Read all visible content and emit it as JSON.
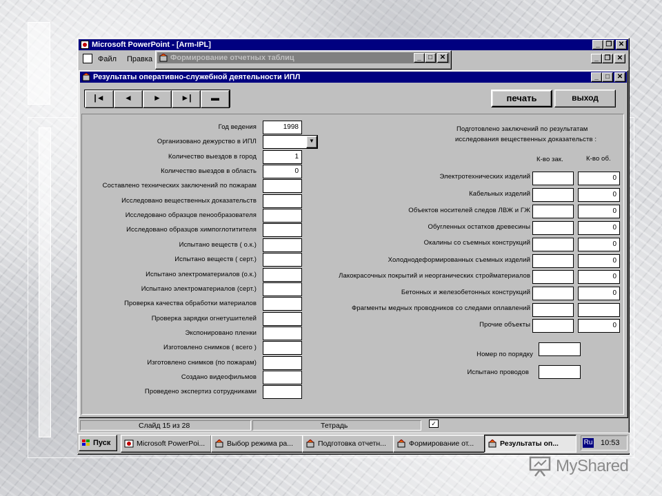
{
  "powerpoint": {
    "title": "Microsoft PowerPoint - [Arm-IPL]",
    "menu": [
      "Файл",
      "Правка"
    ]
  },
  "window_forming": {
    "title": "Формирование отчетных таблиц"
  },
  "window_results": {
    "title": "Результаты оперативно-служебной деятельности  ИПЛ"
  },
  "toolbar": {
    "nav": [
      "|◄",
      "◄",
      "►",
      "►|",
      "▬"
    ],
    "print_label": "печать",
    "exit_label": "выход"
  },
  "left_form": [
    {
      "label": "Год ведения",
      "value": "1998",
      "type": "text"
    },
    {
      "label": "Организовано дежурство в ИПЛ",
      "value": "",
      "type": "combo"
    },
    {
      "label": "Количество выездов в город",
      "value": "1",
      "type": "text"
    },
    {
      "label": "Количество выездов в область",
      "value": "0",
      "type": "text"
    },
    {
      "label": "Составлено технических заключений по пожарам",
      "value": "",
      "type": "text"
    },
    {
      "label": "Исследовано вещественных доказательств",
      "value": "",
      "type": "text"
    },
    {
      "label": "Исследовано образцов пенообразователя",
      "value": "",
      "type": "text"
    },
    {
      "label": "Исследовано образцов химпоглотитителя",
      "value": "",
      "type": "text"
    },
    {
      "label": "Испытано веществ ( о.к.)",
      "value": "",
      "type": "text"
    },
    {
      "label": "Испытано веществ ( серт.)",
      "value": "",
      "type": "text"
    },
    {
      "label": "Испытано электроматериалов (о.к.)",
      "value": "",
      "type": "text"
    },
    {
      "label": "Испытано электроматериалов (серт.)",
      "value": "",
      "type": "text"
    },
    {
      "label": "Проверка качества обработки материалов",
      "value": "",
      "type": "text"
    },
    {
      "label": "Проверка зарядки огнетушителей",
      "value": "",
      "type": "text"
    },
    {
      "label": "Экспонировано пленки",
      "value": "",
      "type": "text"
    },
    {
      "label": "Изготовлено снимков ( всего )",
      "value": "",
      "type": "text"
    },
    {
      "label": "Изготовлено снимков (по пожарам)",
      "value": "",
      "type": "text"
    },
    {
      "label": "Создано видеофильмов",
      "value": "",
      "type": "text"
    },
    {
      "label": "Проведено экспертиз сотрудниками",
      "value": "",
      "type": "text"
    }
  ],
  "right_panel": {
    "heading_line1": "Подготовлено заключений по результатам",
    "heading_line2": "исследования вещественных доказательств :",
    "col1": "К-во зак.",
    "col2": "К-во об.",
    "rows": [
      {
        "label": "Электротехнических изделий",
        "zak": "",
        "ob": "0"
      },
      {
        "label": "Кабельных изделий",
        "zak": "",
        "ob": "0"
      },
      {
        "label": "Объектов носителей следов ЛВЖ и ГЖ",
        "zak": "",
        "ob": "0"
      },
      {
        "label": "Обугленных остатков древесины",
        "zak": "",
        "ob": "0"
      },
      {
        "label": "Окалины со съемных конструкций",
        "zak": "",
        "ob": "0"
      },
      {
        "label": "Холоднодеформированных съемных изделий",
        "zak": "",
        "ob": "0"
      },
      {
        "label": "Лакокрасочных покрытий и неорганических стройматериалов",
        "zak": "",
        "ob": "0"
      },
      {
        "label": "Бетонных и железобетонных конструкций",
        "zak": "",
        "ob": "0"
      },
      {
        "label": "Фрагменты медных проводников со следами оплавлений",
        "zak": "",
        "ob": ""
      },
      {
        "label": "Прочие объекты",
        "zak": "",
        "ob": "0"
      }
    ],
    "order_number_label": "Номер по порядку",
    "wires_label": "Испытано проводов"
  },
  "statusbar": {
    "slide": "Слайд 15 из 28",
    "design": "Тетрадь"
  },
  "taskbar": {
    "start": "Пуск",
    "items": [
      "Microsoft PowerPoi...",
      "Выбор режима ра...",
      "Подготовка отчетн...",
      "Формирование от...",
      "Результаты оп..."
    ],
    "lang": "Ru",
    "clock": "10:53"
  },
  "watermark": "MyShared",
  "colors": {
    "titlebar_active": "#000080",
    "titlebar_inactive": "#808080",
    "face": "#c0c0c0"
  }
}
